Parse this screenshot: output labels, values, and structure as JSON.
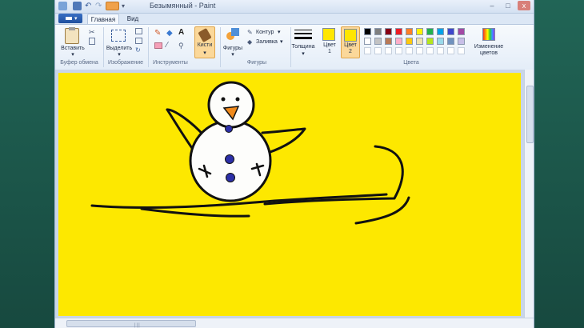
{
  "titlebar": {
    "title": "Безымянный - Paint",
    "minimize": "–",
    "maximize": "□",
    "close": "x"
  },
  "tabs": [
    {
      "label": "Главная",
      "active": true
    },
    {
      "label": "Вид",
      "active": false
    }
  ],
  "ribbon": {
    "clipboard": {
      "paste_label": "Вставить",
      "group_label": "Буфер обмена"
    },
    "image": {
      "select_label": "Выделить",
      "group_label": "Изображение"
    },
    "tools": {
      "group_label": "Инструменты"
    },
    "brushes": {
      "label": "Кисти"
    },
    "shapes": {
      "label": "Фигуры",
      "outline_label": "Контур",
      "fill_label": "Заливка",
      "group_label": "Фигуры"
    },
    "size": {
      "label": "Толщина"
    },
    "color1": {
      "label_line1": "Цвет",
      "label_line2": "1",
      "color": "#ffe600"
    },
    "color2": {
      "label_line1": "Цвет",
      "label_line2": "2",
      "color": "#ffe600"
    },
    "colors": {
      "group_label": "Цвета",
      "edit_line1": "Изменение",
      "edit_line2": "цветов"
    }
  },
  "palette": {
    "row1": [
      "#000000",
      "#7f7f7f",
      "#880015",
      "#ed1c24",
      "#ff7f27",
      "#fff200",
      "#22b14c",
      "#00a2e8",
      "#3f48cc",
      "#a349a4"
    ],
    "row2": [
      "#ffffff",
      "#c3c3c3",
      "#b97a57",
      "#ffaec9",
      "#ffc90e",
      "#efe4b0",
      "#b5e61d",
      "#99d9ea",
      "#7092be",
      "#c8bfe7"
    ],
    "row3": [
      "#ffffff",
      "#ffffff",
      "#ffffff",
      "#ffffff",
      "#ffffff",
      "#ffffff",
      "#ffffff",
      "#ffffff",
      "#ffffff",
      "#ffffff"
    ]
  },
  "canvas": {
    "background": "#fde800",
    "drawing": "snowman-on-skis",
    "stroke": "#111111",
    "button_color": "#2c2fa8",
    "nose_color": "#f08a1c"
  }
}
